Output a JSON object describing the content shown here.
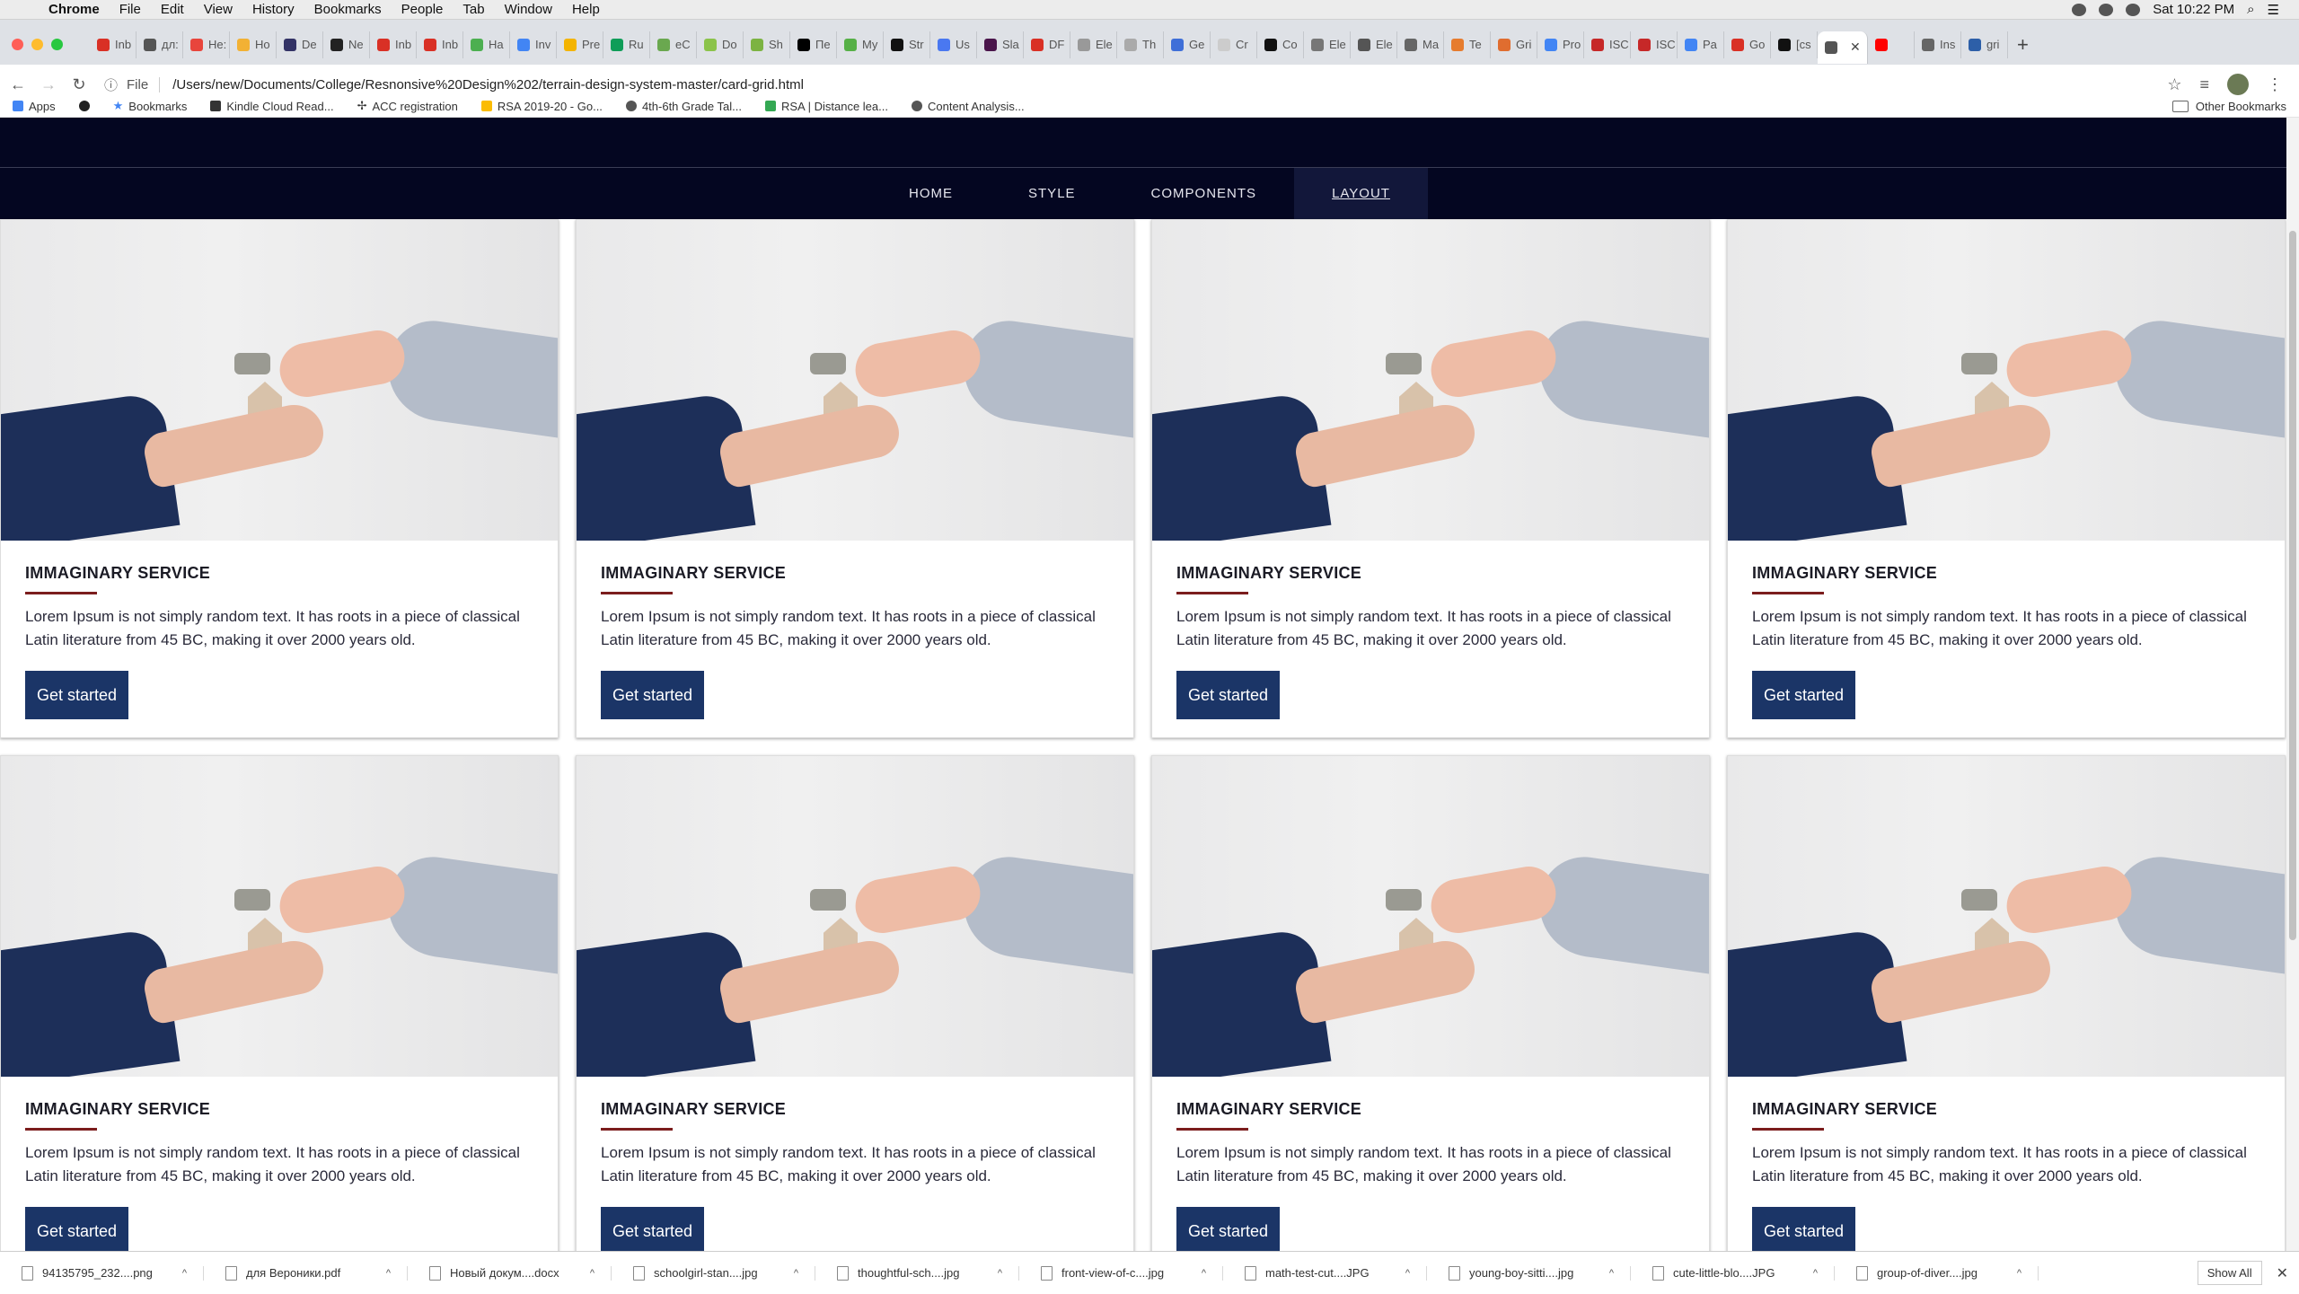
{
  "menubar": {
    "app": "Chrome",
    "items": [
      "File",
      "Edit",
      "View",
      "History",
      "Bookmarks",
      "People",
      "Tab",
      "Window",
      "Help"
    ],
    "clock": "Sat 10:22 PM"
  },
  "tabs": [
    {
      "label": "Inb",
      "color": "#d93025"
    },
    {
      "label": "дл:",
      "color": "#555555"
    },
    {
      "label": "He:",
      "color": "#e8453c"
    },
    {
      "label": "Ho",
      "color": "#f2b134"
    },
    {
      "label": "De",
      "color": "#333366"
    },
    {
      "label": "Ne",
      "color": "#222222"
    },
    {
      "label": "Inb",
      "color": "#d93025"
    },
    {
      "label": "Inb",
      "color": "#d93025"
    },
    {
      "label": "Ha",
      "color": "#4caf50"
    },
    {
      "label": "Inv",
      "color": "#4285f4"
    },
    {
      "label": "Pre",
      "color": "#f4b400"
    },
    {
      "label": "Ru",
      "color": "#0f9d58"
    },
    {
      "label": "eC",
      "color": "#6aa84f"
    },
    {
      "label": "Do",
      "color": "#8bc34a"
    },
    {
      "label": "Sh",
      "color": "#7cb342"
    },
    {
      "label": "Пе",
      "color": "#000000"
    },
    {
      "label": "My",
      "color": "#56b047"
    },
    {
      "label": "Str",
      "color": "#111111"
    },
    {
      "label": "Us",
      "color": "#4a78f0"
    },
    {
      "label": "Sla",
      "color": "#4a154b"
    },
    {
      "label": "DF",
      "color": "#d93025"
    },
    {
      "label": "Ele",
      "color": "#999999"
    },
    {
      "label": "Th",
      "color": "#aaaaaa"
    },
    {
      "label": "Ge",
      "color": "#3f6fd8"
    },
    {
      "label": "Cr",
      "color": "#cccccc"
    },
    {
      "label": "Co",
      "color": "#111111"
    },
    {
      "label": "Ele",
      "color": "#777777"
    },
    {
      "label": "Ele",
      "color": "#555555"
    },
    {
      "label": "Ma",
      "color": "#666666"
    },
    {
      "label": "Te",
      "color": "#e67c2e"
    },
    {
      "label": "Gri",
      "color": "#e06d2f"
    },
    {
      "label": "Pro",
      "color": "#4285f4"
    },
    {
      "label": "ISC",
      "color": "#c62828"
    },
    {
      "label": "ISC",
      "color": "#c62828"
    },
    {
      "label": "Pa",
      "color": "#4285f4"
    },
    {
      "label": "Go",
      "color": "#d93025"
    },
    {
      "label": "[cs",
      "color": "#111111"
    },
    {
      "label": "",
      "color": "#555555",
      "active": true
    },
    {
      "label": "",
      "color": "#ff0000"
    },
    {
      "label": "Ins",
      "color": "#666666"
    },
    {
      "label": "gri",
      "color": "#2d5fa8"
    }
  ],
  "toolbar": {
    "scheme": "File",
    "url": "/Users/new/Documents/College/Resnonsive%20Design%202/terrain-design-system-master/card-grid.html"
  },
  "bookmarks": {
    "items": [
      "Apps",
      "",
      "Bookmarks",
      "Kindle Cloud Read...",
      "ACC registration",
      "RSA 2019-20 - Go...",
      "4th-6th Grade Tal...",
      "RSA | Distance lea...",
      "Content Analysis..."
    ],
    "other": "Other Bookmarks"
  },
  "site_nav": {
    "items": [
      "HOME",
      "STYLE",
      "COMPONENTS",
      "LAYOUT"
    ],
    "active": "LAYOUT"
  },
  "cards": [
    {
      "title": "IMMAGINARY SERVICE",
      "text": "Lorem Ipsum is not simply random text. It has roots in a piece of classical Latin literature from 45 BC, making it over 2000 years old.",
      "button": "Get started"
    },
    {
      "title": "IMMAGINARY SERVICE",
      "text": "Lorem Ipsum is not simply random text. It has roots in a piece of classical Latin literature from 45 BC, making it over 2000 years old.",
      "button": "Get started"
    },
    {
      "title": "IMMAGINARY SERVICE",
      "text": "Lorem Ipsum is not simply random text. It has roots in a piece of classical Latin literature from 45 BC, making it over 2000 years old.",
      "button": "Get started"
    },
    {
      "title": "IMMAGINARY SERVICE",
      "text": "Lorem Ipsum is not simply random text. It has roots in a piece of classical Latin literature from 45 BC, making it over 2000 years old.",
      "button": "Get started"
    },
    {
      "title": "IMMAGINARY SERVICE",
      "text": "Lorem Ipsum is not simply random text. It has roots in a piece of classical Latin literature from 45 BC, making it over 2000 years old.",
      "button": "Get started"
    },
    {
      "title": "IMMAGINARY SERVICE",
      "text": "Lorem Ipsum is not simply random text. It has roots in a piece of classical Latin literature from 45 BC, making it over 2000 years old.",
      "button": "Get started"
    },
    {
      "title": "IMMAGINARY SERVICE",
      "text": "Lorem Ipsum is not simply random text. It has roots in a piece of classical Latin literature from 45 BC, making it over 2000 years old.",
      "button": "Get started"
    },
    {
      "title": "IMMAGINARY SERVICE",
      "text": "Lorem Ipsum is not simply random text. It has roots in a piece of classical Latin literature from 45 BC, making it over 2000 years old.",
      "button": "Get started"
    }
  ],
  "downloads": {
    "files": [
      "94135795_232....png",
      "для Вероники.pdf",
      "Новый докум....docx",
      "schoolgirl-stan....jpg",
      "thoughtful-sch....jpg",
      "front-view-of-c....jpg",
      "math-test-cut....JPG",
      "young-boy-sitti....jpg",
      "cute-little-blo....JPG",
      "group-of-diver....jpg"
    ],
    "show_all": "Show All"
  },
  "colors": {
    "site_header": "#040621",
    "button": "#1b3567",
    "title_rule": "#7b1d1d"
  }
}
